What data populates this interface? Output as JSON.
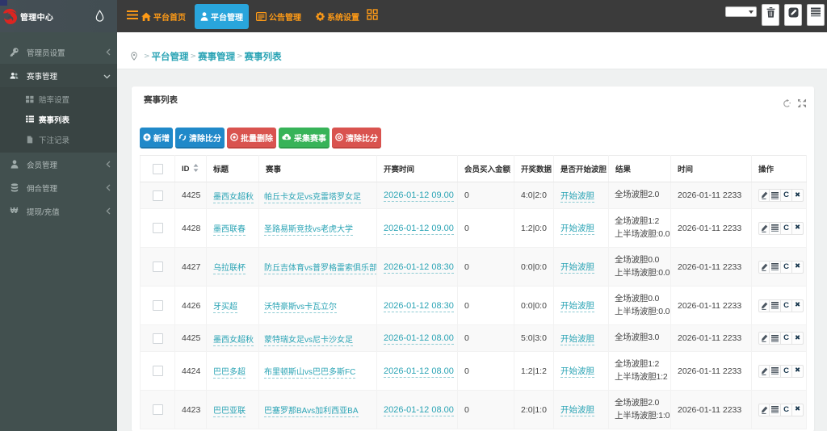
{
  "brand": {
    "title": "管理中心"
  },
  "topnav": {
    "tabs": [
      {
        "label": "平台首页",
        "icon": "home-icon",
        "active": false
      },
      {
        "label": "平台管理",
        "icon": "user-icon",
        "active": true
      },
      {
        "label": "公告管理",
        "icon": "list-alt-icon",
        "active": false
      },
      {
        "label": "系统设置",
        "icon": "gear-icon",
        "active": false
      }
    ],
    "active_tab_color": "#29a5dc",
    "tab_text_color": "#fe9a16"
  },
  "sidebar": {
    "items": [
      {
        "label": "管理员设置",
        "icon": "key-icon",
        "state": "collapsed"
      },
      {
        "label": "赛事管理",
        "icon": "users-icon",
        "state": "expanded",
        "children": [
          {
            "label": "赔率设置",
            "icon": "th-grid-icon",
            "active": false
          },
          {
            "label": "赛事列表",
            "icon": "th-list-icon",
            "active": true
          },
          {
            "label": "下注记录",
            "icon": "file-icon",
            "active": false
          }
        ]
      },
      {
        "label": "会员管理",
        "icon": "user-icon",
        "state": "collapsed"
      },
      {
        "label": "佣合管理",
        "icon": "database-icon",
        "state": "collapsed"
      },
      {
        "label": "提现/充值",
        "icon": "won-icon",
        "state": "collapsed"
      }
    ]
  },
  "breadcrumb": {
    "items": [
      "平台管理",
      "赛事管理",
      "赛事列表"
    ]
  },
  "panel": {
    "title": "赛事列表",
    "tools": [
      "refresh-icon",
      "expand-icon"
    ]
  },
  "toolbar": {
    "buttons": [
      {
        "label": "新增",
        "color": "#2089c9",
        "icon": "plus-circle-icon"
      },
      {
        "label": "清除比分",
        "color": "#2089c9",
        "icon": "refresh-icon"
      },
      {
        "label": "批量删除",
        "color": "#d9534f",
        "icon": "remove-circle-icon"
      },
      {
        "label": "采集赛事",
        "color": "#37b358",
        "icon": "cloud-download-icon"
      },
      {
        "label": "清除比分",
        "color": "#d9534f",
        "icon": "circle-o-icon"
      }
    ]
  },
  "table": {
    "headers": {
      "id": "ID",
      "title": "标题",
      "match": "赛事",
      "start": "开赛时间",
      "amount": "会员买入金额",
      "draw": "开奖数据",
      "action": "是否开始波胆",
      "result": "结果",
      "time": "时间",
      "ops": "操作"
    },
    "rows": [
      {
        "id": "4425",
        "title": "墨西女超秋",
        "match": "帕丘卡女足vs克雷塔罗女足",
        "start": "2026-01-12 09.00",
        "amount": "0",
        "draw": "4:0|2:0",
        "action": "开始波胆",
        "result1": "全场波胆2.0",
        "result2": "",
        "time": "2026-01-11 2233"
      },
      {
        "id": "4428",
        "title": "墨西联春",
        "match": "圣路易斯竞技vs老虎大学",
        "start": "2026-01-12 09.00",
        "amount": "0",
        "draw": "1:2|0:0",
        "action": "开始波胆",
        "result1": "全场波胆1:2",
        "result2": "上半场波胆:0.0",
        "time": "2026-01-11 2233"
      },
      {
        "id": "4427",
        "title": "乌拉联杯",
        "match": "防丘吉体育vs普罗格雷索俱乐部",
        "start": "2026-01-12 08:30",
        "amount": "0",
        "draw": "0:0|0:0",
        "action": "开始波胆",
        "result1": "全场波胆0.0",
        "result2": "上半场波胆:0.0",
        "time": "2026-01-11 2233"
      },
      {
        "id": "4426",
        "title": "牙买超",
        "match": "沃特豪斯vs卡瓦立尔",
        "start": "2026-01-12 08:30",
        "amount": "0",
        "draw": "0:0|0:0",
        "action": "开始波胆",
        "result1": "全场波胆0.0",
        "result2": "上半场波胆:0.0",
        "time": "2026-01-11 2233"
      },
      {
        "id": "4425",
        "title": "墨西女超秋",
        "match": "蒙特瑞女足vs尼卡沙女足",
        "start": "2026-01-12 08.00",
        "amount": "0",
        "draw": "5:0|3:0",
        "action": "开始波胆",
        "result1": "全场波胆3.0",
        "result2": "",
        "time": "2026-01-11 2233"
      },
      {
        "id": "4424",
        "title": "巴巴多超",
        "match": "布里顿斯山vs巴巴多斯FC",
        "start": "2026-01-12 08.00",
        "amount": "0",
        "draw": "1:2|1:2",
        "action": "开始波胆",
        "result1": "全场波胆1:2",
        "result2": "上半场波胆1:2",
        "time": "2026-01-11 2233"
      },
      {
        "id": "4423",
        "title": "巴巴亚联",
        "match": "巴塞罗那BAvs加利西亚BA",
        "start": "2026-01-12 08.00",
        "amount": "0",
        "draw": "2:0|1:0",
        "action": "开始波胆",
        "result1": "全场波胆2.0",
        "result2": "上半场波胆:1:0",
        "time": "2026-01-11 2233"
      }
    ],
    "op_icons": [
      "pencil-icon",
      "list-icon",
      "refresh-c-icon",
      "close-icon"
    ],
    "link_color": "#2ba4b5",
    "stripe_color": "#f9f9f9"
  }
}
